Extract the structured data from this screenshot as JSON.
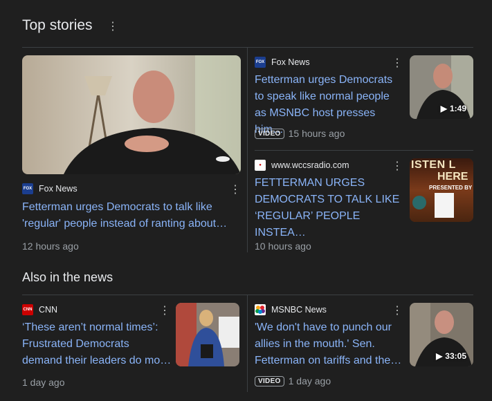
{
  "sections": {
    "top_stories": "Top stories",
    "also_in_news": "Also in the news"
  },
  "kebab": "⋮",
  "stories": [
    {
      "source": "Fox News",
      "headline_l1": "Fetterman urges Democrats to talk like",
      "headline_l2": "'regular' people instead of ranting about…",
      "time": "12 hours ago"
    },
    {
      "source": "Fox News",
      "headline_l1": "Fetterman urges Democrats",
      "headline_l2": "to speak like normal people",
      "headline_l3": "as MSNBC host presses him…",
      "badge": "VIDEO",
      "time": "15 hours ago",
      "duration": "1:49"
    },
    {
      "source": "www.wccsradio.com",
      "headline_l1": "FETTERMAN URGES",
      "headline_l2": "DEMOCRATS TO TALK LIKE",
      "headline_l3": "‘REGULAR’ PEOPLE INSTEA…",
      "time": "10 hours ago",
      "thumb_text_l1": "ISTEN L",
      "thumb_text_l2": "HERE",
      "thumb_text_l3": "PRESENTED BY"
    }
  ],
  "news": [
    {
      "source": "CNN",
      "headline_l1": "‘These aren’t normal times’:",
      "headline_l2": "Frustrated Democrats",
      "headline_l3": "demand their leaders do mo…",
      "time": "1 day ago"
    },
    {
      "source": "MSNBC News",
      "headline_l1": "'We don't have to punch our",
      "headline_l2": "allies in the mouth.' Sen.",
      "headline_l3": "Fetterman on tariffs and the…",
      "badge": "VIDEO",
      "time": "1 day ago",
      "duration": "33:05"
    }
  ],
  "colors": {
    "background": "#1f1f1f",
    "link": "#8ab4f8",
    "meta": "#9aa0a6"
  }
}
